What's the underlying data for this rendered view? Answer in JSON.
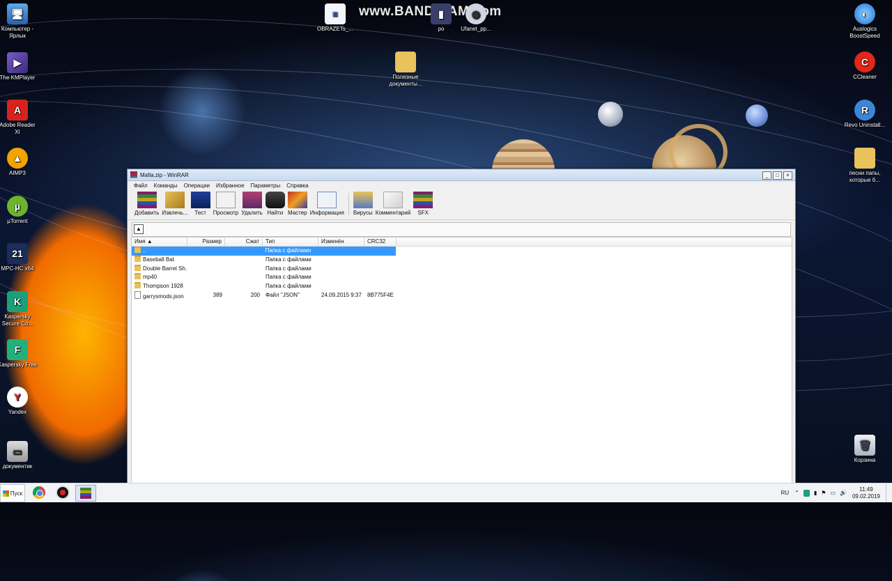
{
  "watermark": "www.BANDICAM.com",
  "desktop_icons": {
    "computer": "Компьютер - Ярлык",
    "kmplayer": "The KMPlayer",
    "adobe": "Adobe Reader XI",
    "aimp": "AIMP3",
    "utorrent": "µTorrent",
    "mpc": "MPC-HC x64",
    "kaspersky_secure": "Kaspersky Secure Co...",
    "kaspersky_free": "Kaspersky Free",
    "yandex": "Yandex",
    "documents": "документик",
    "obrazets": "OBRAZETs_...",
    "po": "po",
    "ufanet": "Ufanet_pp...",
    "useful_docs": "Полезные документы...",
    "auslogics": "Auslogics BoostSpeed",
    "ccleaner": "CCleaner",
    "revo": "Revo Uninstall...",
    "songs_folder": "песни папы, которые б...",
    "recycle": "Корзина"
  },
  "window": {
    "title": "Mafia.zip - WinRAR",
    "controls": [
      "_",
      "□",
      "×"
    ]
  },
  "menu": [
    "Файл",
    "Команды",
    "Операции",
    "Избранное",
    "Параметры",
    "Справка"
  ],
  "toolbar": [
    "Добавить",
    "Извлечь...",
    "Тест",
    "Просмотр",
    "Удалить",
    "Найти",
    "Мастер",
    "Информация",
    "Вирусы",
    "Комментарий",
    "SFX"
  ],
  "columns": {
    "name": "Имя",
    "size": "Размер",
    "packed": "Сжат",
    "type": "Тип",
    "modified": "Изменён",
    "crc": "CRC32"
  },
  "files": [
    {
      "name": "..",
      "size": "",
      "packed": "",
      "type": "Папка с файлами",
      "modified": "",
      "crc": "",
      "kind": "up"
    },
    {
      "name": "Baseball Bat",
      "size": "",
      "packed": "",
      "type": "Папка с файлами",
      "modified": "",
      "crc": "",
      "kind": "folder"
    },
    {
      "name": "Double Barrel Sh...",
      "size": "",
      "packed": "",
      "type": "Папка с файлами",
      "modified": "",
      "crc": "",
      "kind": "folder"
    },
    {
      "name": "mp40",
      "size": "",
      "packed": "",
      "type": "Папка с файлами",
      "modified": "",
      "crc": "",
      "kind": "folder"
    },
    {
      "name": "Thompson 1928",
      "size": "",
      "packed": "",
      "type": "Папка с файлами",
      "modified": "",
      "crc": "",
      "kind": "folder"
    },
    {
      "name": "garrysmods.json",
      "size": "389",
      "packed": "200",
      "type": "Файл \"JSON\"",
      "modified": "24.09.2015 9:37",
      "crc": "8B775F4E",
      "kind": "file"
    }
  ],
  "taskbar": {
    "start": "Пуск",
    "lang": "RU",
    "time": "11:49",
    "date": "09.02.2019"
  },
  "colors": {
    "selection": "#3399ff",
    "titlebar": "#dde9f7"
  }
}
